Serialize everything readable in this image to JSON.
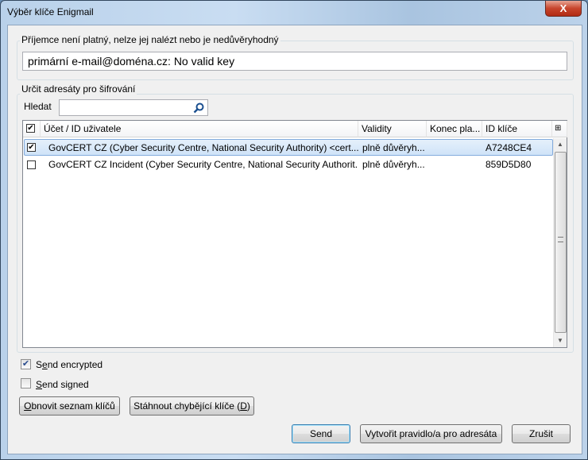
{
  "window": {
    "title": "Výběr klíče Enigmail",
    "close_label": "X"
  },
  "recipient_group": {
    "legend": "Příjemce není platný, nelze jej nalézt nebo je nedůvěryhodný",
    "value": "primární e-mail@doména.cz:  No valid key"
  },
  "encrypt_group": {
    "legend": "Určit adresáty pro šifrování",
    "search_label": "Hledat",
    "search_value": ""
  },
  "table": {
    "columns": [
      "Účet / ID uživatele",
      "Validity",
      "Konec pla...",
      "ID klíče"
    ],
    "header_checked": true,
    "rows": [
      {
        "checked": true,
        "selected": true,
        "account": "GovCERT CZ (Cyber Security Centre, National Security Authority) <cert...",
        "validity": "plně důvěryh...",
        "expiry": "",
        "key_id": "A7248CE4"
      },
      {
        "checked": false,
        "selected": false,
        "account": "GovCERT CZ Incident (Cyber Security Centre, National Security Authorit...",
        "validity": "plně důvěryh...",
        "expiry": "",
        "key_id": "859D5D80"
      }
    ]
  },
  "options": {
    "send_encrypted": {
      "pre": "S",
      "key": "e",
      "post": "nd encrypted",
      "checked": true
    },
    "send_signed": {
      "pre": "",
      "key": "S",
      "post": "end signed",
      "checked": false
    }
  },
  "buttons": {
    "refresh": {
      "key": "O",
      "post": "bnovit seznam klíčů"
    },
    "download": {
      "pre": "Stáhnout chybějící klíče (",
      "key": "D",
      "post": ")"
    },
    "send": "Send",
    "create_rule": "Vytvořit pravidlo/a pro adresáta",
    "cancel": "Zrušit"
  },
  "icons": {
    "search": "search-icon",
    "column_picker": "column-picker-icon"
  }
}
